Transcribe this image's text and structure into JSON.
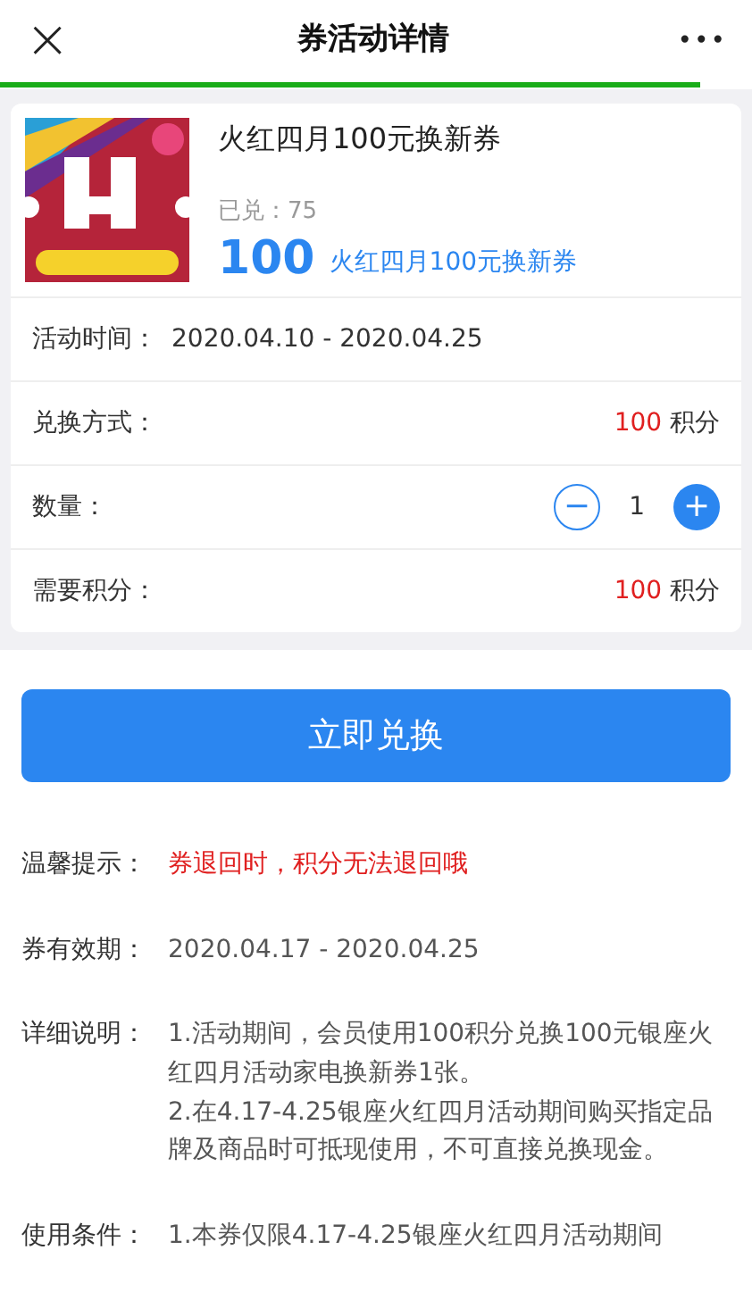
{
  "header": {
    "title": "券活动详情",
    "close": "×",
    "more": "•••"
  },
  "loading_bar": {
    "level": 0.93
  },
  "coupon": {
    "kind": "picture",
    "name": "火红四月100元换新券",
    "redeemed_label": "已兑：",
    "redeemed_count": "75",
    "price": "100",
    "price_note": "火红四月100元换新券"
  },
  "rows": [
    {
      "kind": "text",
      "label": "活动时间：",
      "value": "2020.04.10 - 2020.04.25"
    },
    {
      "kind": "points",
      "label": "兑换方式：",
      "amount": "100",
      "unit": "积分"
    },
    {
      "kind": "stepper",
      "label": "数量：",
      "minus": "−",
      "value": "1",
      "plus": "+"
    },
    {
      "kind": "points",
      "label": "需要积分：",
      "amount": "100",
      "unit": "积分"
    }
  ],
  "redeem_button": "立即兑换",
  "notes": [
    {
      "kind": "warning",
      "label": "温馨提示：",
      "lines": [
        "券退回时，积分无法退回哦"
      ]
    },
    {
      "kind": "plain",
      "label": "券有效期：",
      "lines": [
        "2020.04.17 - 2020.04.25"
      ]
    },
    {
      "kind": "plain",
      "label": "详细说明：",
      "lines": [
        "1.活动期间，会员使用100积分兑换100元银座火红四月活动家电换新券1张。",
        "2.在4.17-4.25银座火红四月活动期间购买指定品牌及商品时可抵现使用，不可直接兑换现金。"
      ]
    },
    {
      "kind": "plain",
      "label": "使用条件：",
      "lines": [
        "1.本券仅限4.17-4.25银座火红四月活动期间"
      ]
    }
  ]
}
